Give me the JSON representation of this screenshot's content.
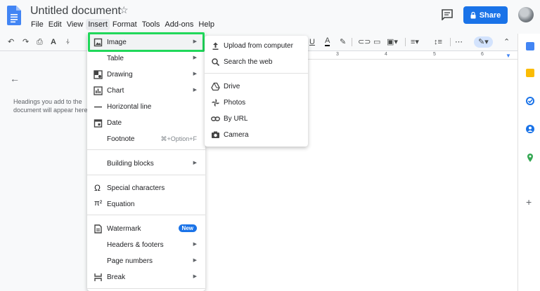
{
  "header": {
    "doc_title": "Untitled document",
    "menus": [
      "File",
      "Edit",
      "View",
      "Insert",
      "Format",
      "Tools",
      "Add-ons",
      "Help"
    ],
    "active_menu": "Insert",
    "share_label": "Share"
  },
  "ruler": {
    "ticks": [
      "3",
      "4",
      "5",
      "6"
    ]
  },
  "outline": {
    "hint": "Headings you add to the document will appear here."
  },
  "insert_menu": {
    "items": [
      {
        "label": "Image",
        "icon": "image-icon",
        "arrow": true
      },
      {
        "label": "Table",
        "icon": "",
        "arrow": true
      },
      {
        "label": "Drawing",
        "icon": "drawing-icon",
        "arrow": true
      },
      {
        "label": "Chart",
        "icon": "chart-icon",
        "arrow": true
      },
      {
        "label": "Horizontal line",
        "icon": "horizontal-line-icon"
      },
      {
        "label": "Date",
        "icon": "calendar-icon"
      },
      {
        "label": "Footnote",
        "shortcut": "⌘+Option+F"
      },
      {
        "label": "Building blocks",
        "arrow": true
      },
      {
        "label": "Special characters",
        "icon": "omega-icon"
      },
      {
        "label": "Equation",
        "icon": "pi-icon"
      },
      {
        "label": "Watermark",
        "icon": "watermark-icon",
        "badge": "New"
      },
      {
        "label": "Headers & footers",
        "arrow": true
      },
      {
        "label": "Page numbers",
        "arrow": true
      },
      {
        "label": "Break",
        "icon": "break-icon",
        "arrow": true
      }
    ]
  },
  "image_submenu": {
    "items": [
      {
        "label": "Upload from computer",
        "icon": "upload-icon"
      },
      {
        "label": "Search the web",
        "icon": "search-icon"
      },
      {
        "label": "Drive",
        "icon": "drive-icon"
      },
      {
        "label": "Photos",
        "icon": "photos-icon"
      },
      {
        "label": "By URL",
        "icon": "link-icon"
      },
      {
        "label": "Camera",
        "icon": "camera-icon"
      }
    ]
  },
  "colors": {
    "accent": "#1a73e8",
    "highlight_box": "#20d85a"
  }
}
